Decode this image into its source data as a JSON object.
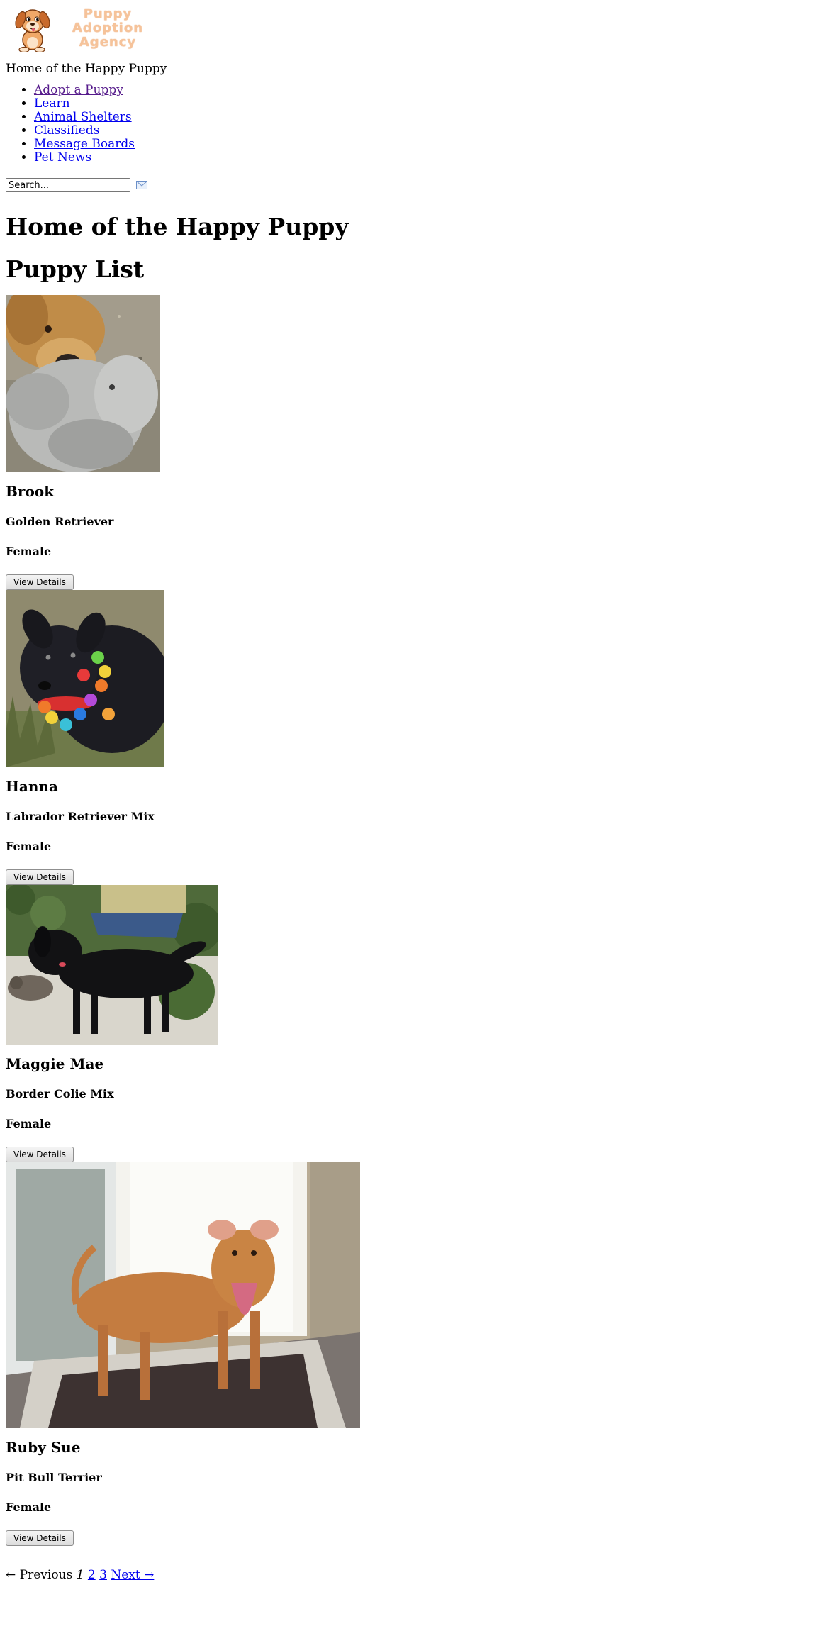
{
  "logo": {
    "text_lines": [
      "Puppy",
      "Adoption",
      "Agency"
    ],
    "icon": "puppy-mascot-icon"
  },
  "tagline": "Home of the Happy Puppy",
  "nav": [
    {
      "label": "Adopt a Puppy",
      "visited": true
    },
    {
      "label": "Learn"
    },
    {
      "label": "Animal Shelters"
    },
    {
      "label": "Classifieds"
    },
    {
      "label": "Message Boards"
    },
    {
      "label": "Pet News"
    }
  ],
  "search": {
    "value": "Search...",
    "icon": "envelope-icon"
  },
  "page_title": "Home of the Happy Puppy",
  "list_title": "Puppy List",
  "puppies": [
    {
      "name": "Brook",
      "breed": "Golden Retriever",
      "sex": "Female",
      "button": "View Details"
    },
    {
      "name": "Hanna",
      "breed": "Labrador Retriever Mix",
      "sex": "Female",
      "button": "View Details"
    },
    {
      "name": "Maggie Mae",
      "breed": "Border Colie Mix",
      "sex": "Female",
      "button": "View Details"
    },
    {
      "name": "Ruby Sue",
      "breed": "Pit Bull Terrier",
      "sex": "Female",
      "button": "View Details"
    }
  ],
  "pager": {
    "previous": "← Previous",
    "current": "1",
    "pages": [
      "2",
      "3"
    ],
    "next": "Next →"
  },
  "colors": {
    "link": "#0000ee",
    "visited": "#551a8b",
    "logo_text": "#f6c39a"
  }
}
